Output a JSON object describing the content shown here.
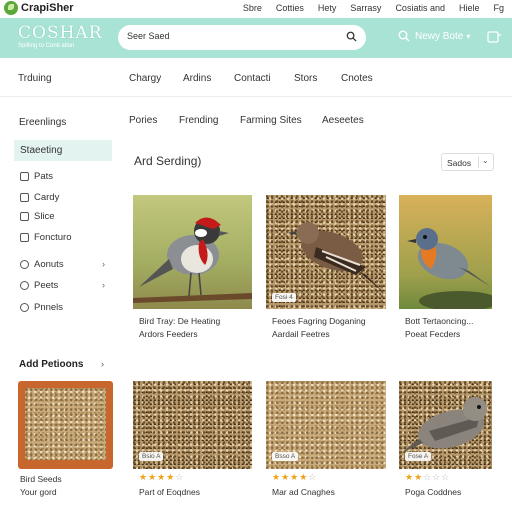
{
  "topbar": {
    "brand": "CrapiSher",
    "links": [
      "Sbre",
      "Cotties",
      "Hety",
      "Sarrasy",
      "Cosiatis and",
      "Hiele",
      "Fg"
    ]
  },
  "header": {
    "brand": "COSHAR",
    "brand_sub": "Spilling to Conti ation",
    "search_placeholder": "Seer Saed",
    "account_label": "Newy Bote",
    "accent_color": "#a9e3d6"
  },
  "nav": {
    "items": [
      "Trduing",
      "Chargy",
      "Ardins",
      "Contacti",
      "Stors",
      "Cnotes"
    ]
  },
  "subnav": {
    "items": [
      "Pories",
      "Frending",
      "Farming Sites",
      "Aeseetes"
    ]
  },
  "sidebar": {
    "title": "Ereenlings",
    "active": "Staeeting",
    "items": [
      {
        "label": "Pats",
        "icon": "tag-icon"
      },
      {
        "label": "Cardy",
        "icon": "card-icon"
      },
      {
        "label": "Slice",
        "icon": "grid-icon"
      },
      {
        "label": "Foncturo",
        "icon": "lock-icon"
      },
      {
        "label": "Aonuts",
        "icon": "circle-icon",
        "arrow": "›"
      },
      {
        "label": "Peets",
        "icon": "circle-icon",
        "arrow": "›"
      },
      {
        "label": "Pnnels",
        "icon": "circle-icon"
      }
    ],
    "section2": "Add Petioons",
    "section2_arrow": "›"
  },
  "main": {
    "title": "Ard Serding)",
    "sort_label": "Sados"
  },
  "products_row1": [
    {
      "line1": "Bird Tray: De Heating",
      "line2": "Ardors Feeders",
      "badge": ""
    },
    {
      "line1": "Feoes Fagring Doganing",
      "line2": "Aardail Feetres",
      "badge": "Fosi 4"
    },
    {
      "line1": "Bott Tertaoncing...",
      "line2": "Poeat Fecders",
      "badge": ""
    }
  ],
  "products_row2": [
    {
      "line1": "Bird Seeds",
      "line2": "Your gord",
      "badge": "",
      "rating": 0
    },
    {
      "line1": "Part of Eoqdnes",
      "line2": "",
      "badge": "Bsio A",
      "rating": 4
    },
    {
      "line1": "Mar ad Cnaghes",
      "line2": "",
      "badge": "Bsso A",
      "rating": 4
    },
    {
      "line1": "Poga Coddnes",
      "line2": "",
      "badge": "Fose A",
      "rating": 2
    }
  ]
}
